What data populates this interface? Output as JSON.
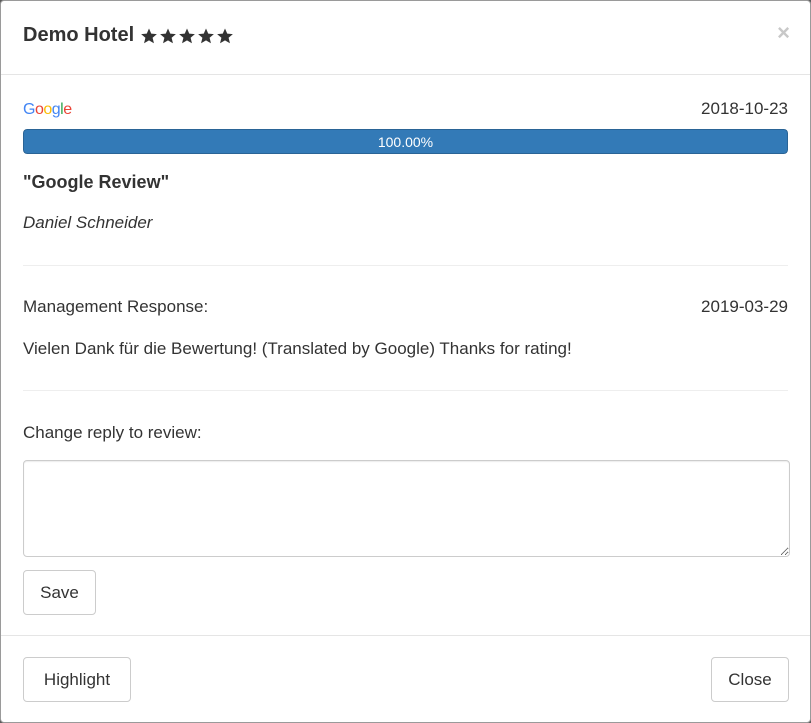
{
  "header": {
    "hotel_name": "Demo Hotel",
    "stars": 5,
    "close_symbol": "×"
  },
  "review": {
    "source_logo_text": "Google",
    "date": "2018-10-23",
    "score_percent": 100,
    "score_label": "100.00%",
    "title": "\"Google Review\"",
    "author": "Daniel Schneider"
  },
  "response": {
    "label": "Management Response:",
    "date": "2019-03-29",
    "text": "Vielen Dank für die Bewertung! (Translated by Google) Thanks for rating!"
  },
  "reply_form": {
    "label": "Change reply to review:",
    "value": "",
    "save_label": "Save"
  },
  "footer": {
    "highlight_label": "Highlight",
    "close_label": "Close"
  },
  "colors": {
    "progress": "#337ab7",
    "star": "#333333",
    "google_blue": "#4285F4",
    "google_red": "#EA4335",
    "google_yellow": "#FBBC05",
    "google_green": "#34A853"
  }
}
